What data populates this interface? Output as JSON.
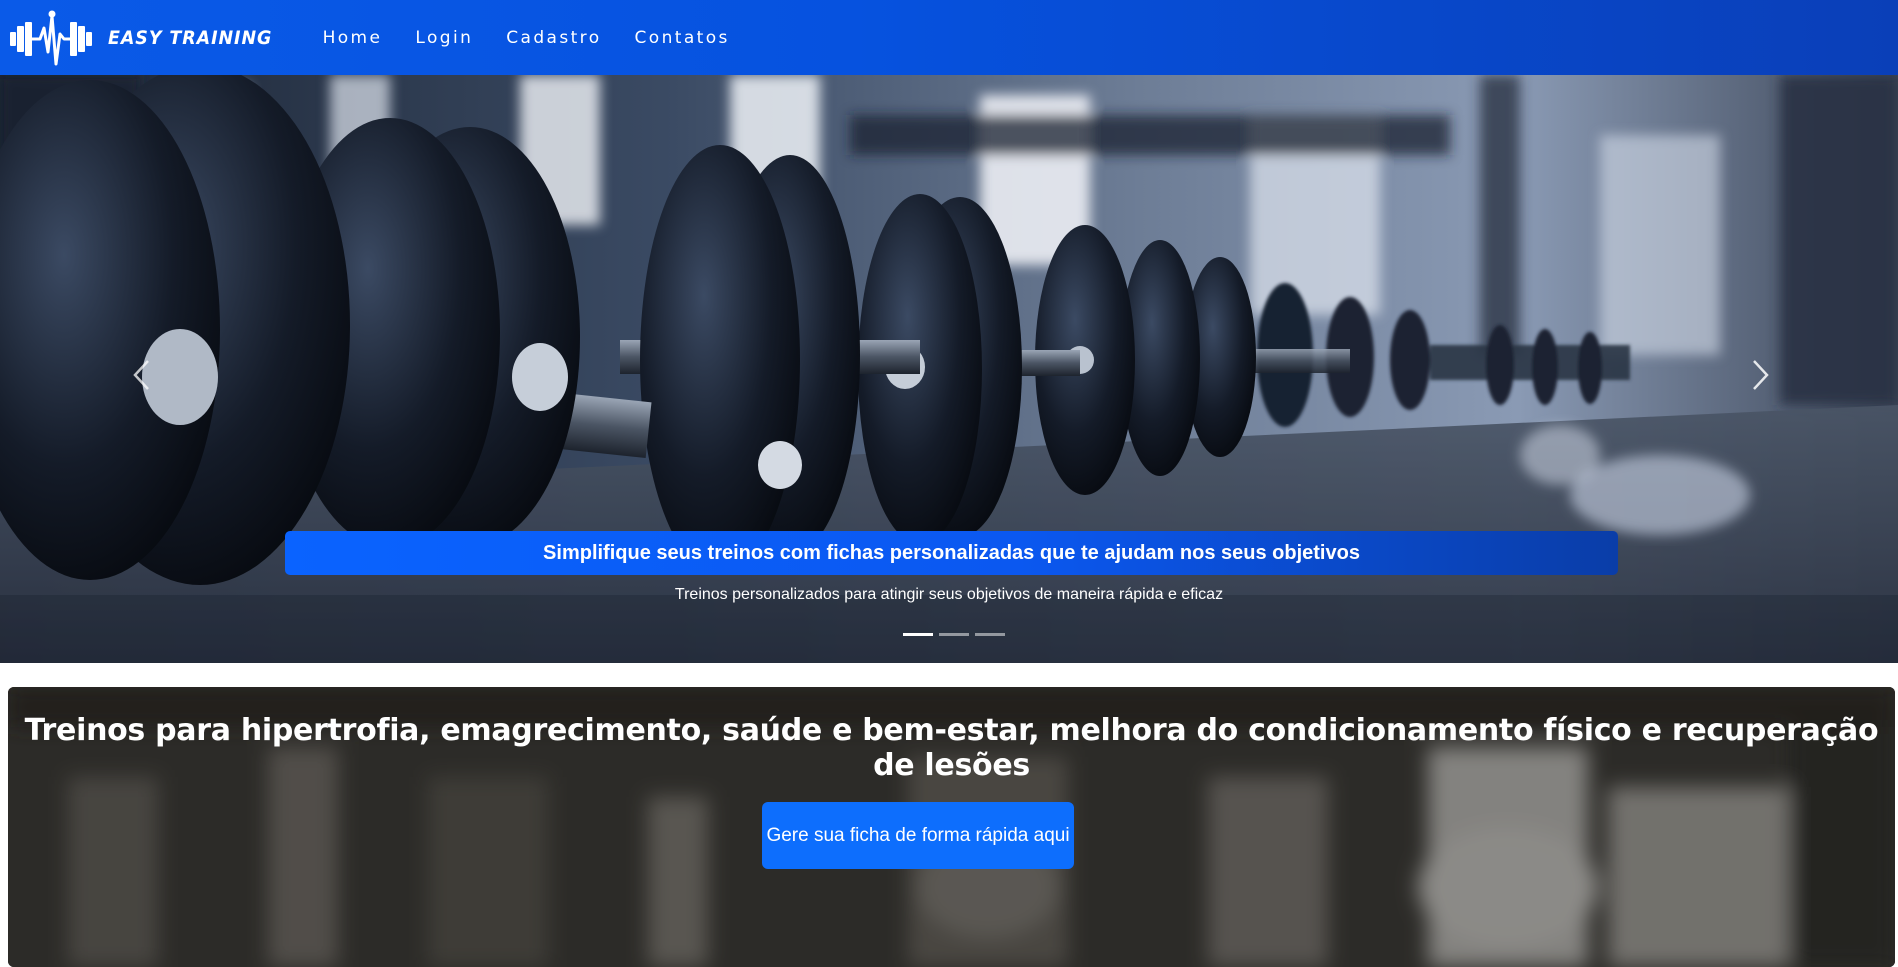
{
  "navbar": {
    "brand_name": "EASY TRAINING",
    "logo_icon": "dumbbell-heartbeat-icon",
    "links": [
      {
        "label": "Home"
      },
      {
        "label": "Login"
      },
      {
        "label": "Cadastro"
      },
      {
        "label": "Contatos"
      }
    ],
    "background_color": "#0652df"
  },
  "carousel": {
    "prev_icon": "chevron-left-icon",
    "next_icon": "chevron-right-icon",
    "caption_title": "Simplifique seus treinos com fichas personalizadas que te ajudam nos seus objetivos",
    "caption_subtitle": "Treinos personalizados para atingir seus objetivos de maneira rápida e eficaz",
    "slides": 3,
    "active_slide": 1
  },
  "feature": {
    "title": "Treinos para hipertrofia, emagrecimento, saúde e bem-estar, melhora do condicionamento físico e recuperação de lesões",
    "cta_label": "Gere sua ficha de forma rápida aqui",
    "cta_color": "#0d6efd"
  }
}
